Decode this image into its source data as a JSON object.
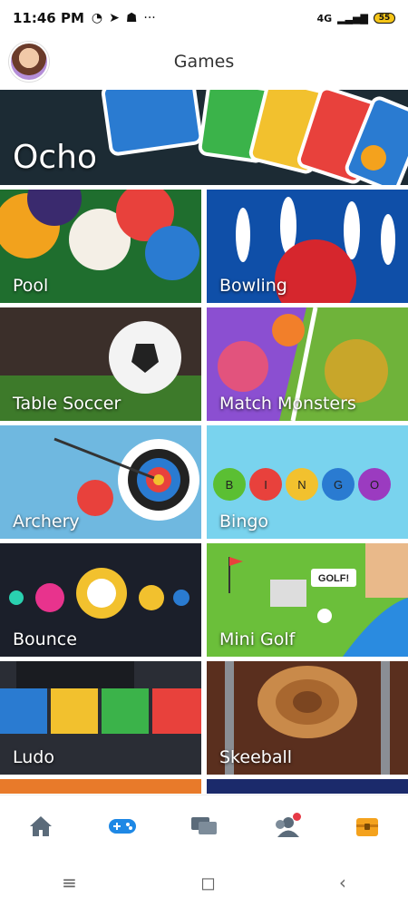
{
  "status": {
    "time": "11:46 PM",
    "network": "4G",
    "battery": "55"
  },
  "header": {
    "title": "Games"
  },
  "hero": {
    "label": "Ocho"
  },
  "tiles": [
    {
      "label": "Pool"
    },
    {
      "label": "Bowling"
    },
    {
      "label": "Table Soccer"
    },
    {
      "label": "Match Monsters"
    },
    {
      "label": "Archery"
    },
    {
      "label": "Bingo"
    },
    {
      "label": "Bounce"
    },
    {
      "label": "Mini Golf"
    },
    {
      "label": "Ludo"
    },
    {
      "label": "Skeeball"
    }
  ],
  "badges": {
    "golf": "GOLF!",
    "bingo": [
      "B",
      "I",
      "N",
      "G",
      "O"
    ]
  },
  "colors": {
    "accent": "#1e88e5",
    "navIcon": "#5b6b7a",
    "badge": "#e63946",
    "chest": "#f4a21d"
  },
  "nav": [
    "home-icon",
    "gamepad-icon",
    "chat-icon",
    "friends-icon",
    "treasure-chest-icon"
  ],
  "system_nav": [
    "≡",
    "◻",
    "‹"
  ]
}
